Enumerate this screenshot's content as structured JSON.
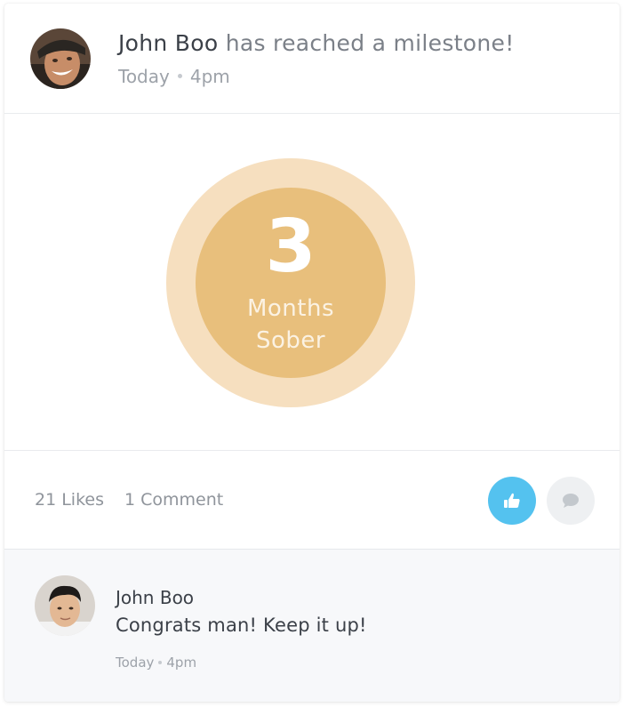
{
  "post": {
    "author": "John Boo",
    "headline_suffix": "has reached a milestone!",
    "day": "Today",
    "time": "4pm"
  },
  "milestone": {
    "number": "3",
    "line1": "Months",
    "line2": "Sober",
    "outer_color": "#f6dfbf",
    "inner_color": "#e8bf7c"
  },
  "stats": {
    "likes": "21 Likes",
    "comments": "1 Comment"
  },
  "actions": {
    "like_icon": "thumbs-up-icon",
    "like_color": "#54c2ef",
    "comment_icon": "speech-bubble-icon"
  },
  "comment": {
    "author": "John Boo",
    "text": "Congrats man! Keep it up!",
    "day": "Today",
    "time": "4pm"
  }
}
